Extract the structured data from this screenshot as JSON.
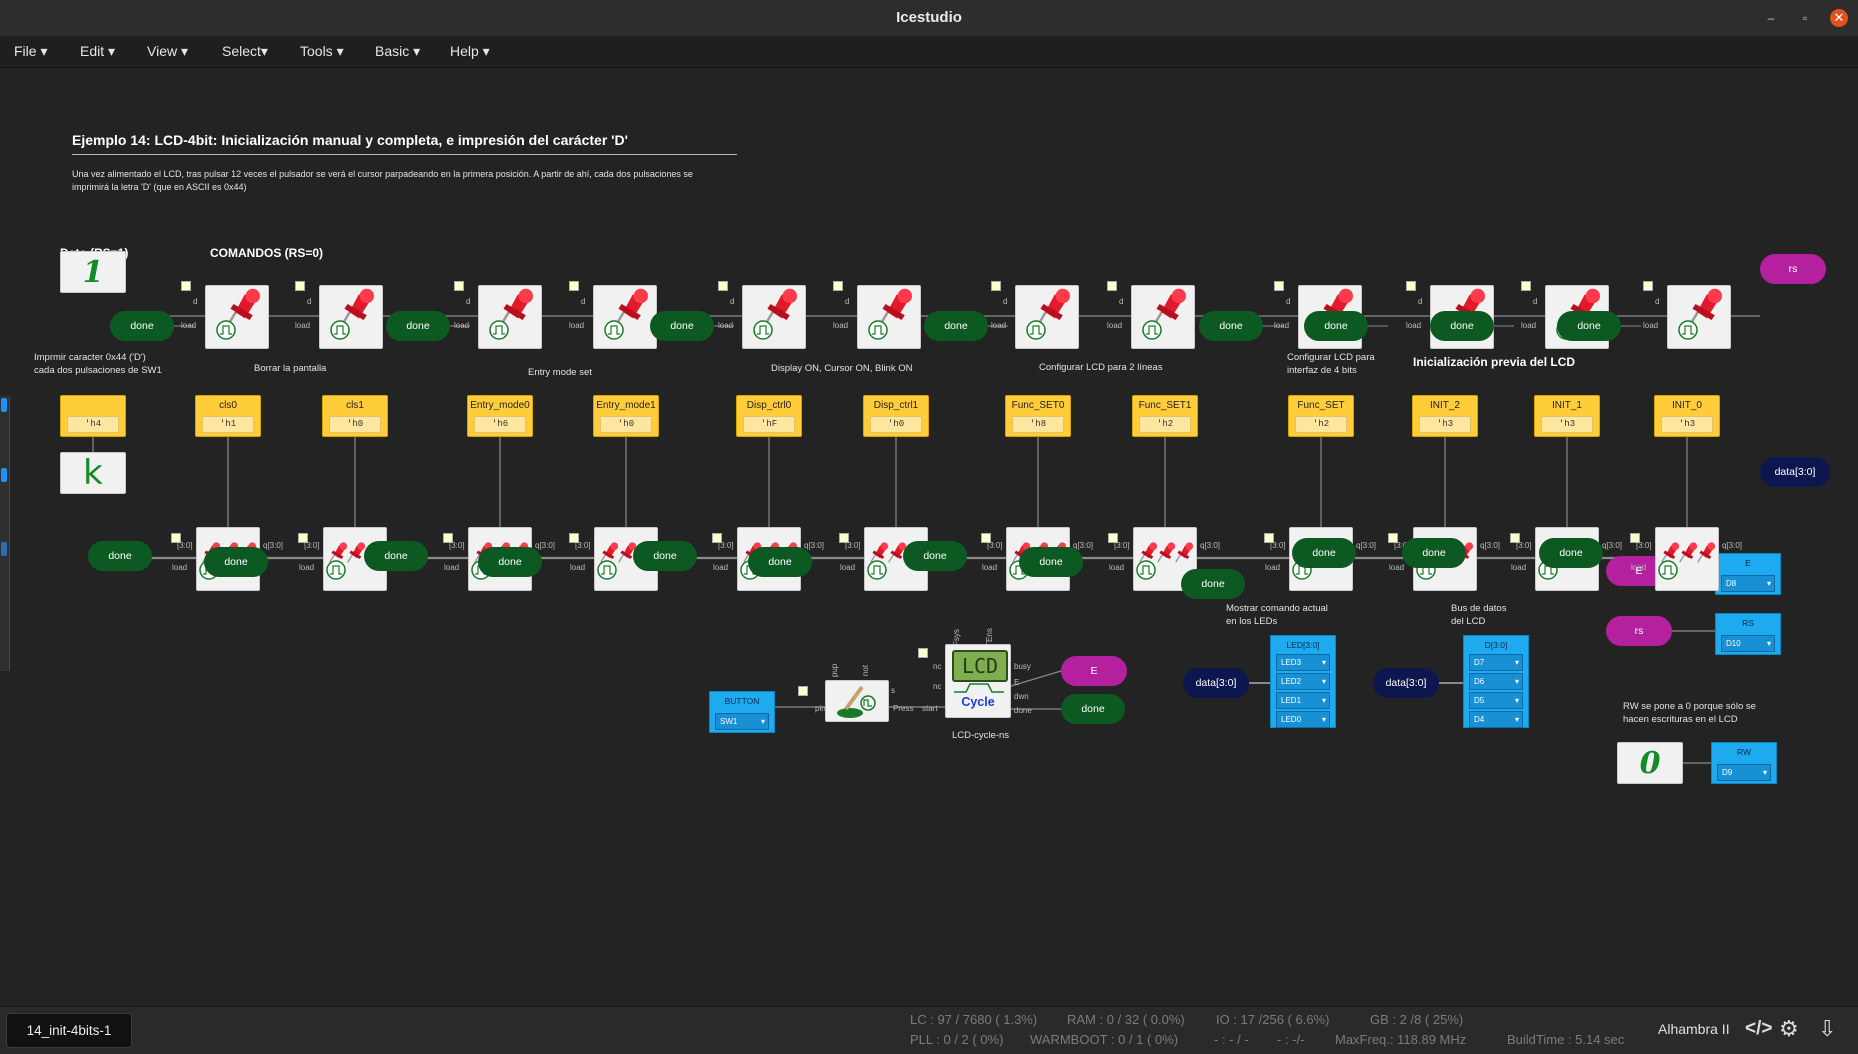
{
  "app": {
    "title": "Icestudio"
  },
  "window_controls": {
    "minimize": "–",
    "maximize": "▫",
    "close": "✕"
  },
  "menu": [
    "File",
    "Edit",
    "View",
    "Select",
    "Tools",
    "Basic",
    "Help"
  ],
  "canvas": {
    "title": "Ejemplo 14: LCD-4bit: Inicialización manual y completa, e impresión del carácter 'D'",
    "desc1": "Una vez alimentado el LCD, tras pulsar 12 veces el pulsador se verá el cursor parpadeando en la primera posición. A partir de ahí, cada dos pulsaciones se",
    "desc2": "imprimirá la letra 'D' (que en ASCII es 0x44)",
    "dato_label": "Dato (RS=1)",
    "comandos_label": "COMANDOS (RS=0)",
    "note_print1": "Imprmir caracter 0x44 ('D')",
    "note_print2": "cada dos pulsaciones de SW1",
    "note_borrar": "Borrar la pantalla",
    "note_entry": "Entry mode set",
    "note_display": "Display ON, Cursor ON, Blink ON",
    "note_config2": "Configurar LCD para 2 líneas",
    "note_config4a": "Configurar LCD para",
    "note_config4b": "interfaz de 4 bits",
    "note_init": "Inicialización previa del LCD",
    "note_mostrar1": "Mostrar comando actual",
    "note_mostrar2": "en los LEDs",
    "note_bus1": "Bus de datos",
    "note_bus2": "del LCD",
    "note_rw1": "RW se pone a 0 porque sólo se",
    "note_rw2": "hacen escrituras en el LCD",
    "const_one": "1",
    "const_k": "k",
    "const_zero": "0",
    "h4_value": "'h4",
    "done": "done",
    "rs": "rs",
    "E": "E",
    "data_out": "data[3:0]",
    "lcd_caption": "LCD-cycle-ns",
    "lcd_screen": "LCD",
    "lcd_cycle": "Cycle",
    "port_d": "d",
    "port_load": "load",
    "port_bus_in": "[3:0]",
    "port_q": "q[3:0]",
    "lcd_ports": {
      "fsys": "Fsys",
      "tens": "TEns",
      "nc": "nc",
      "busy": "busy",
      "e": "E",
      "dwn": "dwn",
      "done": "done",
      "start": "start",
      "press": "Press",
      "pin": "pin",
      "pup": "pup",
      "not": "not",
      "s": "s"
    },
    "constants": [
      {
        "name": "cls0",
        "value": "'h1"
      },
      {
        "name": "cls1",
        "value": "'h0"
      },
      {
        "name": "Entry_mode0",
        "value": "'h6"
      },
      {
        "name": "Entry_mode1",
        "value": "'h0"
      },
      {
        "name": "Disp_ctrl0",
        "value": "'hF"
      },
      {
        "name": "Disp_ctrl1",
        "value": "'h0"
      },
      {
        "name": "Func_SET0",
        "value": "'h8"
      },
      {
        "name": "Func_SET1",
        "value": "'h2"
      },
      {
        "name": "Func_SET",
        "value": "'h2"
      },
      {
        "name": "INIT_2",
        "value": "'h3"
      },
      {
        "name": "INIT_1",
        "value": "'h3"
      },
      {
        "name": "INIT_0",
        "value": "'h3"
      }
    ],
    "pins": {
      "button": {
        "title": "BUTTON",
        "value": "SW1"
      },
      "e": {
        "title": "E",
        "value": "D8"
      },
      "rs": {
        "title": "RS",
        "value": "D10"
      },
      "rw": {
        "title": "RW",
        "value": "D9"
      },
      "led": {
        "title": "LED[3:0]",
        "values": [
          "LED3",
          "LED2",
          "LED1",
          "LED0"
        ]
      },
      "d": {
        "title": "D[3:0]",
        "values": [
          "D7",
          "D6",
          "D5",
          "D4"
        ]
      }
    }
  },
  "status": {
    "file": "14_init-4bits-1",
    "lc": "LC : 97 / 7680 ( 1.3%)",
    "ram": "RAM : 0 / 32 ( 0.0%)",
    "io": "IO : 17 /256 ( 6.6%)",
    "gb": "GB : 2 /8 ( 25%)",
    "pll": "PLL : 0 / 2 ( 0%)",
    "warmboot": "WARMBOOT : 0 / 1 ( 0%)",
    "dash1": "- : - / -",
    "dash2": "- : -/-",
    "maxfreq": "MaxFreq.: 118.89 MHz",
    "buildtime": "BuildTime : 5.14 sec",
    "board": "Alhambra II"
  },
  "colors": {
    "done_green": "#0c5a22",
    "magenta": "#b4209e",
    "navy": "#0e1650",
    "pin_blue": "#1eaaef",
    "const_yellow": "#ffcd39"
  }
}
